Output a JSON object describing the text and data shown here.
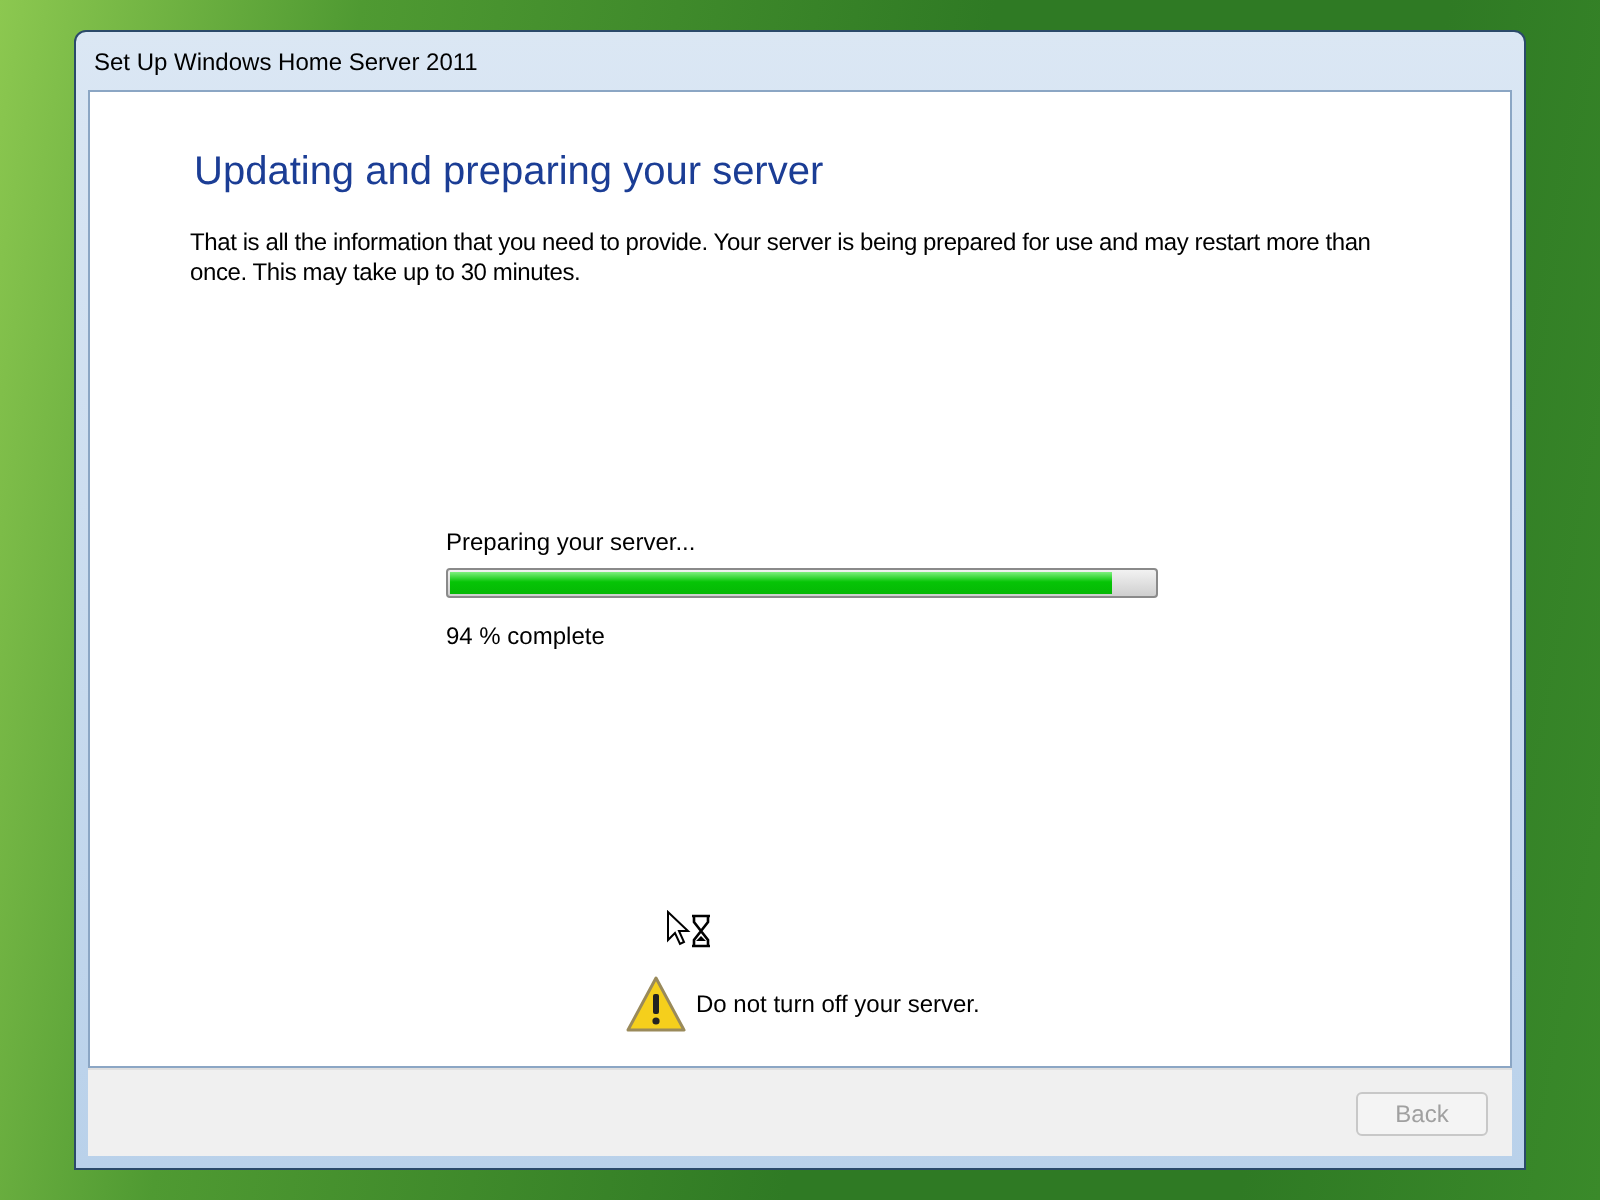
{
  "window": {
    "title": "Set Up Windows Home Server 2011"
  },
  "heading": "Updating and preparing your server",
  "message": "That is all the information that you need to provide. Your server is being prepared for use and may restart more than once. This may take up to 30 minutes.",
  "progress": {
    "label": "Preparing your server...",
    "level": 0.94,
    "reading": "94 % complete"
  },
  "warning": {
    "text": "Do not turn off your server."
  },
  "buttons": [
    {
      "label": "Back",
      "disabled": true
    }
  ]
}
